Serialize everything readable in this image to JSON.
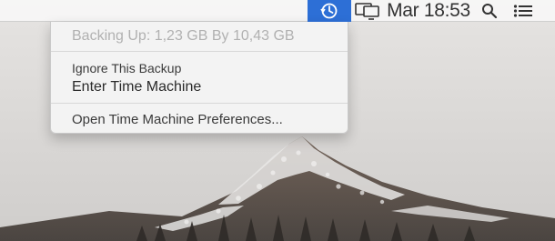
{
  "menubar": {
    "time_machine_icon": "time-machine-icon",
    "display_icon": "display-icon",
    "clock": "Mar 18:53",
    "spotlight_icon": "search-icon",
    "notification_icon": "list-icon",
    "active_color": "#2d6fd6"
  },
  "dropdown": {
    "status": "Backing Up: 1,23 GB By 10,43 GB",
    "items": [
      "Ignore This Backup",
      "Enter Time Machine",
      "Open Time Machine Preferences..."
    ]
  }
}
